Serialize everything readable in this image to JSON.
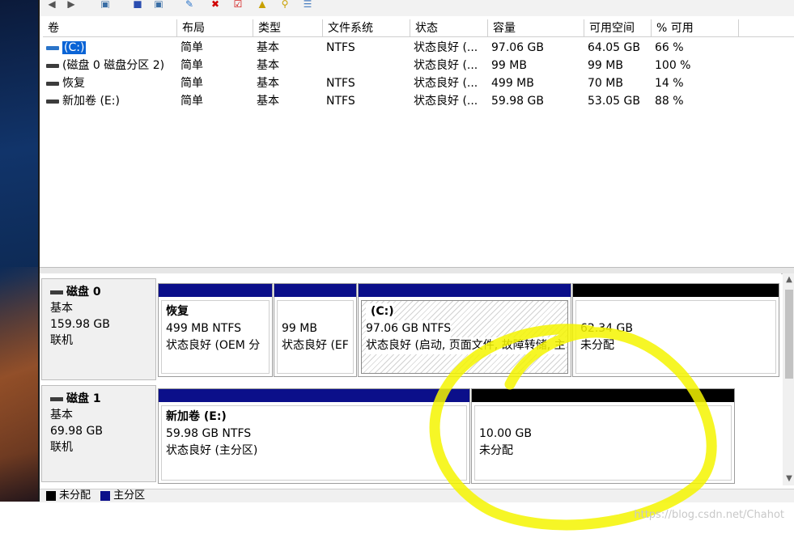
{
  "columns": [
    "卷",
    "布局",
    "类型",
    "文件系统",
    "状态",
    "容量",
    "可用空间",
    "% 可用"
  ],
  "volumes": [
    {
      "name": "(C:)",
      "layout": "简单",
      "type": "基本",
      "fs": "NTFS",
      "status": "状态良好 (...",
      "capacity": "97.06 GB",
      "free": "64.05 GB",
      "pct": "66 %"
    },
    {
      "name": "(磁盘 0 磁盘分区 2)",
      "layout": "简单",
      "type": "基本",
      "fs": "",
      "status": "状态良好 (...",
      "capacity": "99 MB",
      "free": "99 MB",
      "pct": "100 %"
    },
    {
      "name": "恢复",
      "layout": "简单",
      "type": "基本",
      "fs": "NTFS",
      "status": "状态良好 (...",
      "capacity": "499 MB",
      "free": "70 MB",
      "pct": "14 %"
    },
    {
      "name": "新加卷 (E:)",
      "layout": "简单",
      "type": "基本",
      "fs": "NTFS",
      "status": "状态良好 (...",
      "capacity": "59.98 GB",
      "free": "53.05 GB",
      "pct": "88 %"
    }
  ],
  "disks": [
    {
      "name": "磁盘 0",
      "kind": "基本",
      "size": "159.98 GB",
      "state": "联机",
      "partitions": [
        {
          "title": "恢复",
          "line2": "499 MB NTFS",
          "line3": "状态良好 (OEM 分"
        },
        {
          "title": "",
          "line2": "99 MB",
          "line3": "状态良好 (EF"
        },
        {
          "title": "(C:)",
          "line2": "97.06 GB NTFS",
          "line3": "状态良好 (启动, 页面文件, 故障转储, 主"
        },
        {
          "title": "",
          "line2": "62.34 GB",
          "line3": "未分配"
        }
      ]
    },
    {
      "name": "磁盘 1",
      "kind": "基本",
      "size": "69.98 GB",
      "state": "联机",
      "partitions": [
        {
          "title": "新加卷 (E:)",
          "line2": "59.98 GB NTFS",
          "line3": "状态良好 (主分区)"
        },
        {
          "title": "",
          "line2": "10.00 GB",
          "line3": "未分配"
        }
      ]
    }
  ],
  "legend": {
    "unallocated": "未分配",
    "primary": "主分区"
  },
  "watermark": "https://blog.csdn.net/Chahot",
  "colors": {
    "primary_bar": "#0b0f8a",
    "unallocated_bar": "#000000",
    "selection": "#0a64d6",
    "annotation": "#f4f400"
  }
}
